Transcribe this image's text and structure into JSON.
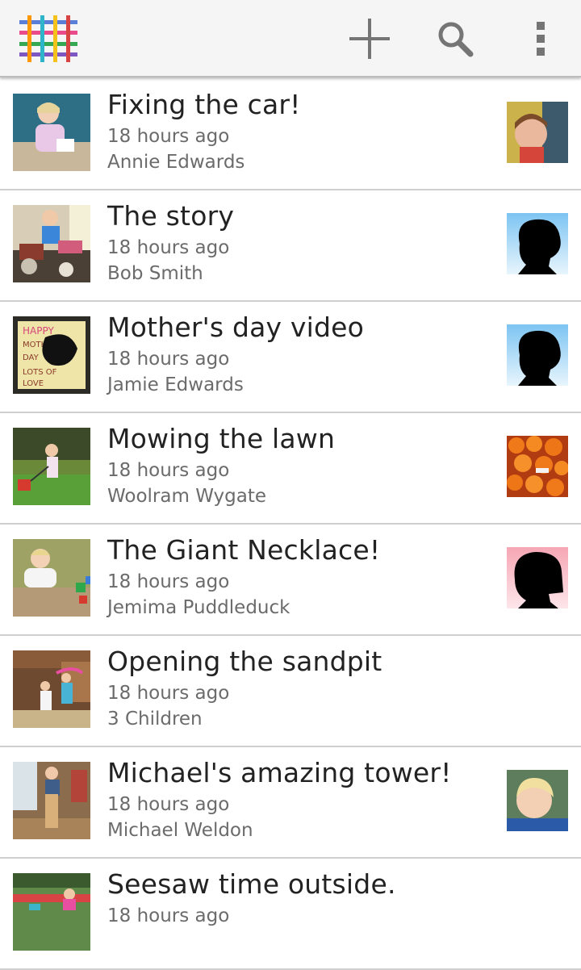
{
  "app": {
    "logo_icon": "woven-grid-logo-icon",
    "actions": [
      {
        "name": "add",
        "icon": "plus-icon"
      },
      {
        "name": "search",
        "icon": "search-icon"
      },
      {
        "name": "more",
        "icon": "overflow-menu-icon"
      }
    ]
  },
  "colors": {
    "app_bar_bg": "#f5f5f5",
    "icon_gray": "#757575",
    "title_text": "#222222",
    "secondary_text": "#6b6b6b",
    "divider": "#cfcfcf"
  },
  "entries": [
    {
      "title": "Fixing the car!",
      "time": "18 hours ago",
      "author": "Annie Edwards",
      "avatar": "child-photo"
    },
    {
      "title": "The story",
      "time": "18 hours ago",
      "author": "Bob Smith",
      "avatar": "silhouette-blue"
    },
    {
      "title": "Mother's day video",
      "time": "18 hours ago",
      "author": "Jamie Edwards",
      "avatar": "silhouette-blue"
    },
    {
      "title": "Mowing the lawn",
      "time": "18 hours ago",
      "author": "Woolram Wygate",
      "avatar": "oranges-photo"
    },
    {
      "title": "The Giant Necklace!",
      "time": "18 hours ago",
      "author": "Jemima Puddleduck",
      "avatar": "silhouette-pink"
    },
    {
      "title": "Opening the sandpit",
      "time": "18 hours ago",
      "author": "3 Children",
      "avatar": ""
    },
    {
      "title": "Michael's amazing tower!",
      "time": "18 hours ago",
      "author": "Michael Weldon",
      "avatar": "child-photo"
    },
    {
      "title": "Seesaw time outside.",
      "time": "18 hours ago",
      "author": "",
      "avatar": ""
    }
  ]
}
